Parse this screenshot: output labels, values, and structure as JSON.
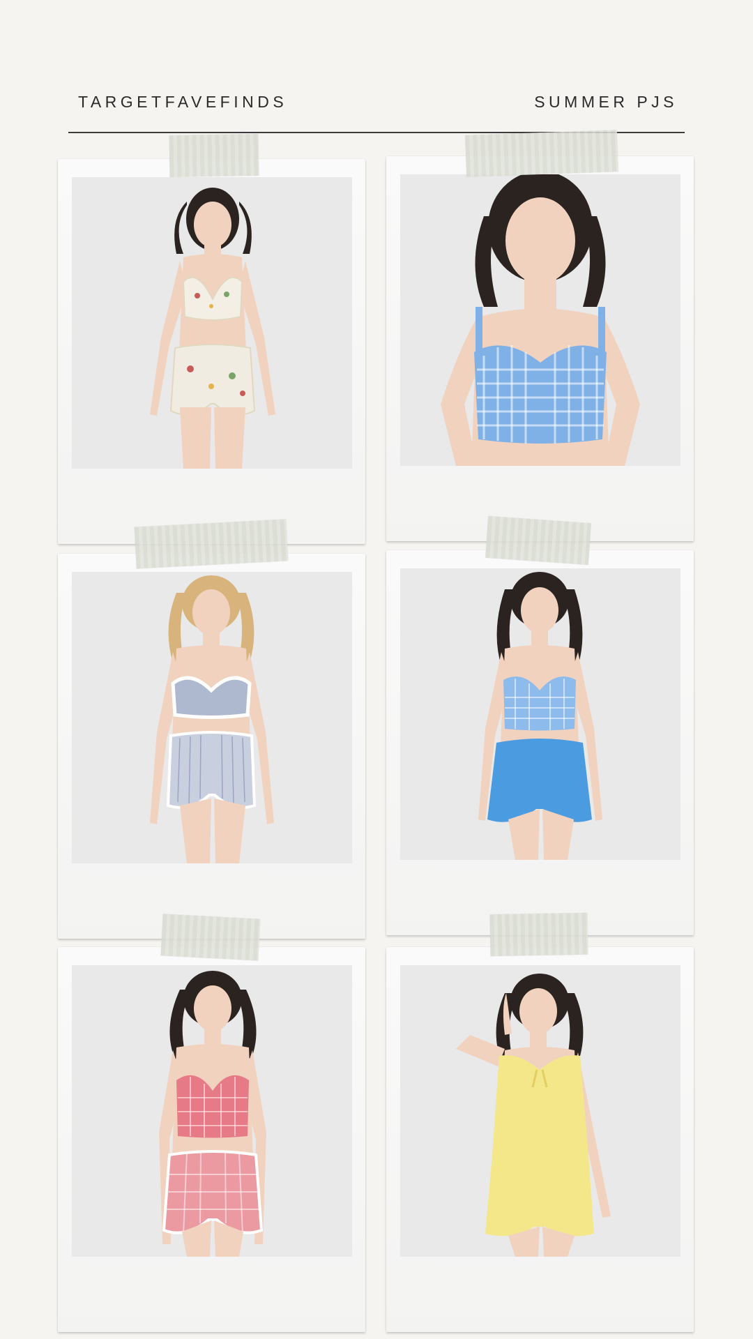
{
  "header": {
    "left_title": "TARGETFAVEFINDS",
    "right_title": "SUMMER PJS"
  },
  "photos": [
    {
      "subject": "pajama-set-floral",
      "hair": "#2b2320",
      "top": "#f3efe4",
      "shorts": "#f1ece2",
      "accent": "#c85a5a"
    },
    {
      "subject": "gingham-bustier-blue",
      "hair": "#2b2320",
      "top": "#7fb1e6",
      "shorts": null,
      "accent": "#ffffff"
    },
    {
      "subject": "striped-set-blue-white",
      "hair": "#d8b47c",
      "top": "#aeb9d0",
      "shorts": "#c8cfdf",
      "accent": "#ffffff"
    },
    {
      "subject": "gingham-set-blue",
      "hair": "#2b2320",
      "top": "#8dbbec",
      "shorts": "#4b9be0",
      "accent": "#ffffff"
    },
    {
      "subject": "gingham-set-pink",
      "hair": "#2b2320",
      "top": "#e67a86",
      "shorts": "#ec9aa2",
      "accent": "#ffffff"
    },
    {
      "subject": "ruffle-set-yellow",
      "hair": "#2b2320",
      "top": "#f4e78a",
      "shorts": "#f4e78a",
      "accent": "#ffffff"
    }
  ]
}
